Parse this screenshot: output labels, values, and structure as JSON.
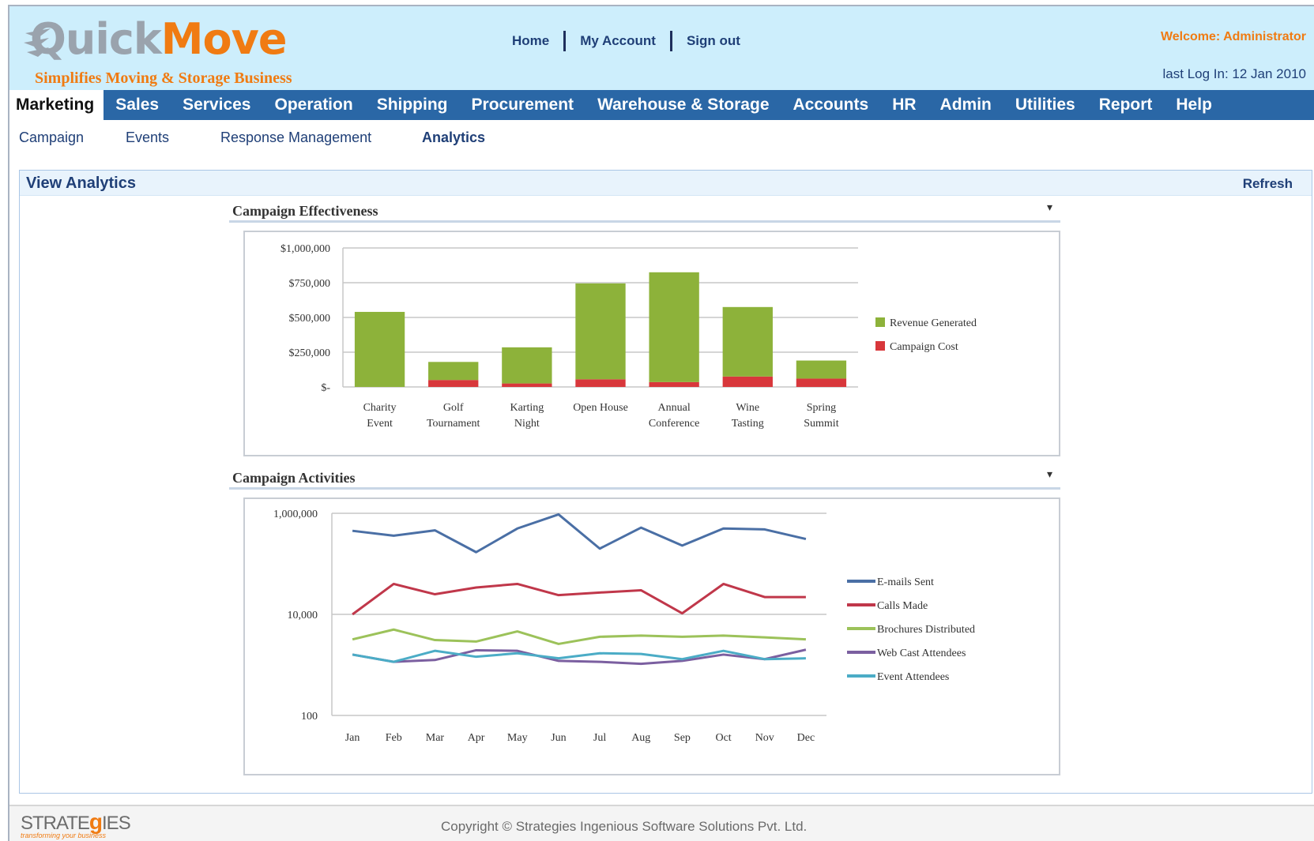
{
  "brand": {
    "logo_part1": "Quick",
    "logo_part2": "Move",
    "tagline": "Simplifies Moving & Storage Business"
  },
  "toplinks": [
    "Home",
    "My Account",
    "Sign out"
  ],
  "user": {
    "welcome": "Welcome: Administrator",
    "last_login": "last Log In: 12 Jan 2010"
  },
  "mainnav": [
    "Marketing",
    "Sales",
    "Services",
    "Operation",
    "Shipping",
    "Procurement",
    "Warehouse & Storage",
    "Accounts",
    "HR",
    "Admin",
    "Utilities",
    "Report",
    "Help"
  ],
  "mainnav_active": "Marketing",
  "subnav": [
    "Campaign",
    "Events",
    "Response Management",
    "Analytics"
  ],
  "subnav_active": "Analytics",
  "panel": {
    "title": "View Analytics",
    "refresh": "Refresh"
  },
  "widgets": {
    "effectiveness_title": "Campaign Effectiveness",
    "activities_title": "Campaign Activities",
    "menu_icon": "▾"
  },
  "colors": {
    "header_bg": "#cdeefc",
    "nav_bg": "#2a67a6",
    "accent_orange": "#f07b12",
    "revenue": "#8db23a",
    "cost": "#d8373b"
  },
  "chart_data": [
    {
      "type": "bar",
      "stacked": true,
      "categories": [
        "Charity Event",
        "Golf Tournament",
        "Karting Night",
        "Open House",
        "Annual Conference",
        "Wine Tasting",
        "Spring Summit"
      ],
      "series": [
        {
          "name": "Revenue Generated",
          "color": "#8db23a",
          "values": [
            540000,
            130000,
            260000,
            690000,
            790000,
            500000,
            130000
          ]
        },
        {
          "name": "Campaign Cost",
          "color": "#d8373b",
          "values": [
            0,
            50000,
            25000,
            55000,
            35000,
            75000,
            60000
          ]
        }
      ],
      "ylim": [
        0,
        1000000
      ],
      "yticks": [
        0,
        250000,
        500000,
        750000,
        1000000
      ],
      "ytick_labels": [
        "$-",
        "$250,000",
        "$500,000",
        "$750,000",
        "$1,000,000"
      ],
      "legend_position": "right",
      "grid": true
    },
    {
      "type": "line",
      "yscale": "log",
      "categories": [
        "Jan",
        "Feb",
        "Mar",
        "Apr",
        "May",
        "Jun",
        "Jul",
        "Aug",
        "Sep",
        "Oct",
        "Nov",
        "Dec"
      ],
      "series": [
        {
          "name": "E-mails Sent",
          "color": "#4a6fa5",
          "values": [
            450000,
            360000,
            460000,
            170000,
            500000,
            950000,
            200000,
            520000,
            230000,
            500000,
            480000,
            310000
          ]
        },
        {
          "name": "Calls Made",
          "color": "#c0374a",
          "values": [
            10000,
            40000,
            25000,
            34000,
            40000,
            24000,
            27000,
            30000,
            10500,
            40000,
            22000,
            22000
          ]
        },
        {
          "name": "Brochures Distributed",
          "color": "#9cc25a",
          "values": [
            3200,
            5000,
            3100,
            2900,
            4600,
            2600,
            3600,
            3800,
            3600,
            3800,
            3500,
            3200
          ]
        },
        {
          "name": "Web Cast Attendees",
          "color": "#7b5fa0",
          "values": [
            1600,
            1150,
            1250,
            1950,
            1900,
            1200,
            1150,
            1050,
            1200,
            1600,
            1300,
            2000
          ]
        },
        {
          "name": "Event Attendees",
          "color": "#4bacc6",
          "values": [
            1600,
            1150,
            1900,
            1450,
            1700,
            1350,
            1700,
            1650,
            1300,
            1900,
            1300,
            1350
          ]
        }
      ],
      "ylim": [
        100,
        1000000
      ],
      "yticks": [
        100,
        10000,
        1000000
      ],
      "ytick_labels": [
        "100",
        "10,000",
        "1,000,000"
      ],
      "legend_position": "right",
      "grid": true
    }
  ],
  "footer": {
    "logo_pre": "STRATE",
    "logo_g": "g",
    "logo_post": "IES",
    "logo_tag": "transforming your business",
    "copyright": "Copyright © Strategies Ingenious Software Solutions Pvt. Ltd."
  }
}
